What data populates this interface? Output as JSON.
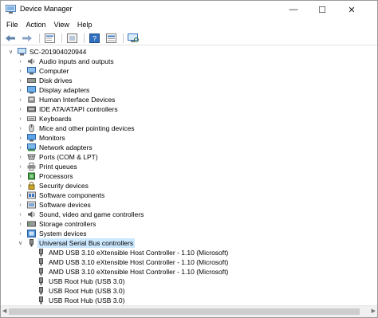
{
  "window": {
    "title": "Device Manager",
    "minimize_glyph": "—",
    "maximize_glyph": "☐",
    "close_glyph": "✕"
  },
  "menu": [
    {
      "label": "File"
    },
    {
      "label": "Action"
    },
    {
      "label": "View"
    },
    {
      "label": "Help"
    }
  ],
  "toolbar": {
    "icons": [
      "back-arrow-icon",
      "forward-arrow-icon",
      "properties-icon",
      "update-driver-icon",
      "help-icon",
      "details-icon",
      "monitor-scan-icon"
    ]
  },
  "tree": {
    "root": {
      "label": "SC-201904020944",
      "expanded": true
    },
    "categories": [
      {
        "label": "Audio inputs and outputs",
        "icon": "speaker-icon"
      },
      {
        "label": "Computer",
        "icon": "computer-icon"
      },
      {
        "label": "Disk drives",
        "icon": "disk-drive-icon"
      },
      {
        "label": "Display adapters",
        "icon": "display-adapter-icon"
      },
      {
        "label": "Human Interface Devices",
        "icon": "hid-icon"
      },
      {
        "label": "IDE ATA/ATAPI controllers",
        "icon": "ide-controller-icon"
      },
      {
        "label": "Keyboards",
        "icon": "keyboard-icon"
      },
      {
        "label": "Mice and other pointing devices",
        "icon": "mouse-icon"
      },
      {
        "label": "Monitors",
        "icon": "monitor-icon"
      },
      {
        "label": "Network adapters",
        "icon": "network-adapter-icon"
      },
      {
        "label": "Ports (COM & LPT)",
        "icon": "port-icon"
      },
      {
        "label": "Print queues",
        "icon": "printer-icon"
      },
      {
        "label": "Processors",
        "icon": "processor-icon"
      },
      {
        "label": "Security devices",
        "icon": "security-device-icon"
      },
      {
        "label": "Software components",
        "icon": "software-component-icon"
      },
      {
        "label": "Software devices",
        "icon": "software-device-icon"
      },
      {
        "label": "Sound, video and game controllers",
        "icon": "sound-controller-icon"
      },
      {
        "label": "Storage controllers",
        "icon": "storage-controller-icon"
      },
      {
        "label": "System devices",
        "icon": "system-device-icon"
      },
      {
        "label": "Universal Serial Bus controllers",
        "icon": "usb-icon",
        "expanded": true,
        "selected": true
      }
    ],
    "usb_children": [
      {
        "label": "AMD USB 3.10 eXtensible Host Controller - 1.10 (Microsoft)"
      },
      {
        "label": "AMD USB 3.10 eXtensible Host Controller - 1.10 (Microsoft)"
      },
      {
        "label": "AMD USB 3.10 eXtensible Host Controller - 1.10 (Microsoft)"
      },
      {
        "label": "USB Root Hub (USB 3.0)"
      },
      {
        "label": "USB Root Hub (USB 3.0)"
      },
      {
        "label": "USB Root Hub (USB 3.0)"
      }
    ]
  },
  "colors": {
    "selection": "#cce8ff",
    "accent": "#1e64c8"
  }
}
